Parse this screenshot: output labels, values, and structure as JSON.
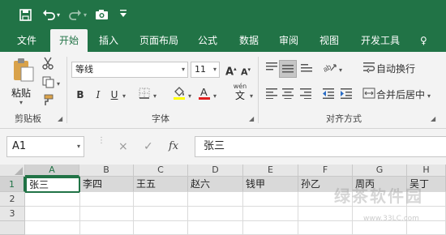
{
  "qat": {
    "save_icon": "save-icon",
    "undo_icon": "undo-icon",
    "redo_icon": "redo-icon",
    "camera_icon": "camera-icon",
    "customize_icon": "customize-qat-icon"
  },
  "tabs": [
    {
      "label": "文件"
    },
    {
      "label": "开始",
      "active": true
    },
    {
      "label": "插入"
    },
    {
      "label": "页面布局"
    },
    {
      "label": "公式"
    },
    {
      "label": "数据"
    },
    {
      "label": "审阅"
    },
    {
      "label": "视图"
    },
    {
      "label": "开发工具"
    },
    {
      "label": "♀"
    }
  ],
  "clipboard": {
    "paste_label": "粘贴",
    "group_label": "剪贴板"
  },
  "font": {
    "name": "等线",
    "size": "11",
    "bold": "B",
    "italic": "I",
    "underline": "U",
    "grow": "A",
    "shrink": "A",
    "wen": "wén",
    "wen_char": "文",
    "group_label": "字体"
  },
  "alignment": {
    "wrap_label": "自动换行",
    "merge_label": "合并后居中",
    "group_label": "对齐方式"
  },
  "formula": {
    "name_box": "A1",
    "cancel": "×",
    "enter": "✓",
    "fx": "fx",
    "content": "张三"
  },
  "grid": {
    "columns": [
      "A",
      "B",
      "C",
      "D",
      "E",
      "F",
      "G",
      "H"
    ],
    "rows": [
      "1",
      "2",
      "3"
    ],
    "row1": [
      "张三",
      "李四",
      "王五",
      "赵六",
      "钱甲",
      "孙乙",
      "周丙",
      "吴丁"
    ]
  },
  "watermark": {
    "text": "绿茶软件园",
    "url": "www.33LC.com"
  },
  "colors": {
    "brand": "#217346",
    "ribbon_bg": "#f3f3f3",
    "highlight_cell": "#d9d9d9"
  }
}
